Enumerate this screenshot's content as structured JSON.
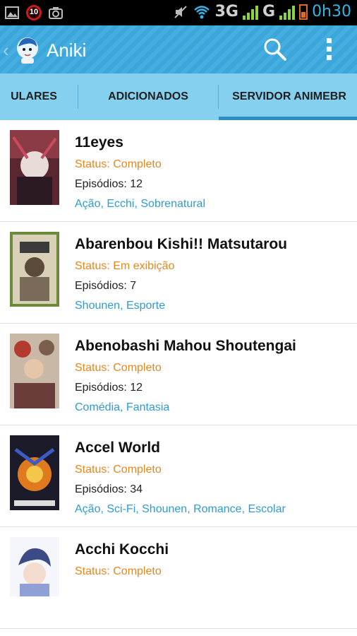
{
  "status_bar": {
    "notification_badge": "10",
    "network_3g": "3G",
    "network_g": "G",
    "time": "0h30"
  },
  "action_bar": {
    "title": "Aniki",
    "colors": {
      "background": "#3ba6d9",
      "title": "#ffffff"
    }
  },
  "tabs": [
    {
      "label": "ULARES",
      "selected": false
    },
    {
      "label": "ADICIONADOS",
      "selected": false
    },
    {
      "label": "SERVIDOR ANIMEBR",
      "selected": true
    }
  ],
  "list": [
    {
      "title": "11eyes",
      "status": "Status: Completo",
      "episodes": "Episódios: 12",
      "genres": "Ação, Ecchi, Sobrenatural"
    },
    {
      "title": "Abarenbou Kishi!! Matsutarou",
      "status": "Status: Em exibição",
      "episodes": "Episódios: 7",
      "genres": "Shounen, Esporte"
    },
    {
      "title": "Abenobashi Mahou Shoutengai",
      "status": "Status: Completo",
      "episodes": "Episódios: 12",
      "genres": "Comédia, Fantasia"
    },
    {
      "title": "Accel World",
      "status": "Status: Completo",
      "episodes": "Episódios: 34",
      "genres": "Ação, Sci-Fi, Shounen, Romance, Escolar"
    },
    {
      "title": "Acchi Kocchi",
      "status": "Status: Completo",
      "episodes": "",
      "genres": ""
    }
  ],
  "colors": {
    "status": "#e8861c",
    "genres": "#2f9bd0",
    "tabs_bg": "#84d0ee"
  }
}
